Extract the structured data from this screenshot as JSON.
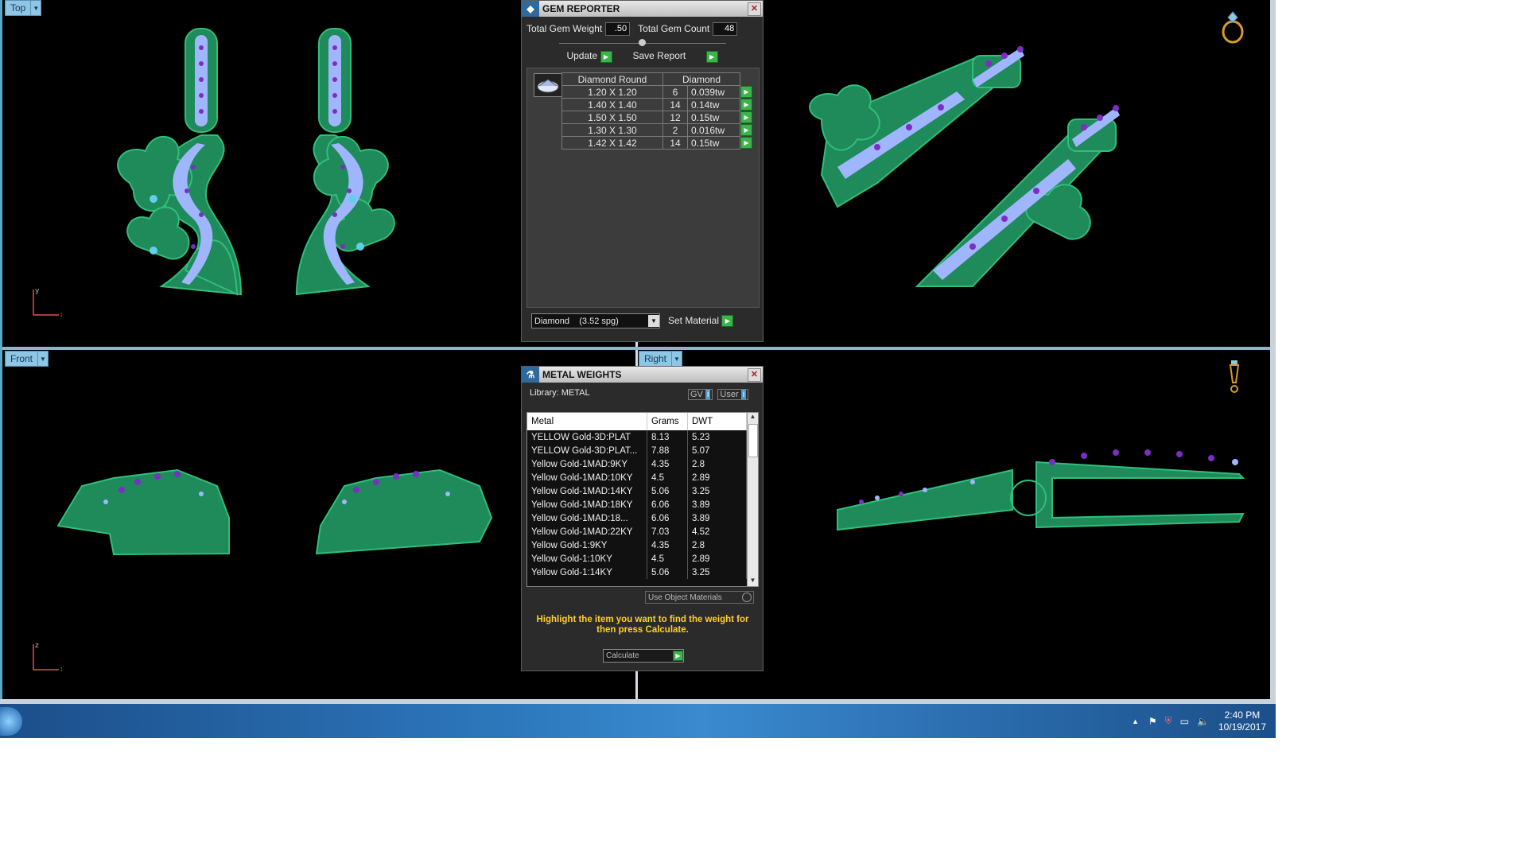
{
  "viewports": {
    "top": {
      "label": "Top"
    },
    "front": {
      "label": "Front"
    },
    "right": {
      "label": "Right"
    }
  },
  "gem_reporter": {
    "title": "GEM REPORTER",
    "total_weight_label": "Total Gem Weight",
    "total_weight_value": ".50",
    "total_count_label": "Total Gem Count",
    "total_count_value": "48",
    "update_label": "Update",
    "save_report_label": "Save Report",
    "columns": [
      "Diamond Round",
      "Diamond"
    ],
    "rows": [
      {
        "size": "1.20 X 1.20",
        "count": "6",
        "weight": "0.039tw"
      },
      {
        "size": "1.40 X 1.40",
        "count": "14",
        "weight": "0.14tw"
      },
      {
        "size": "1.50 X 1.50",
        "count": "12",
        "weight": "0.15tw"
      },
      {
        "size": "1.30 X 1.30",
        "count": "2",
        "weight": "0.016tw"
      },
      {
        "size": "1.42 X 1.42",
        "count": "14",
        "weight": "0.15tw"
      }
    ],
    "material_select": "Diamond    (3.52 spg)",
    "set_material_label": "Set Material"
  },
  "metal_weights": {
    "title": "METAL WEIGHTS",
    "library_label": "Library: METAL",
    "gv_label": "GV",
    "user_label": "User",
    "columns": [
      "Metal",
      "Grams",
      "DWT"
    ],
    "rows": [
      {
        "metal": "YELLOW Gold-3D:PLAT",
        "grams": "8.13",
        "dwt": "5.23"
      },
      {
        "metal": "YELLOW Gold-3D:PLAT...",
        "grams": "7.88",
        "dwt": "5.07"
      },
      {
        "metal": "Yellow Gold-1MAD:9KY",
        "grams": "4.35",
        "dwt": "2.8"
      },
      {
        "metal": "Yellow Gold-1MAD:10KY",
        "grams": "4.5",
        "dwt": "2.89"
      },
      {
        "metal": "Yellow Gold-1MAD:14KY",
        "grams": "5.06",
        "dwt": "3.25"
      },
      {
        "metal": "Yellow Gold-1MAD:18KY",
        "grams": "6.06",
        "dwt": "3.89"
      },
      {
        "metal": "Yellow Gold-1MAD:18...",
        "grams": "6.06",
        "dwt": "3.89"
      },
      {
        "metal": "Yellow Gold-1MAD:22KY",
        "grams": "7.03",
        "dwt": "4.52"
      },
      {
        "metal": "Yellow Gold-1:9KY",
        "grams": "4.35",
        "dwt": "2.8"
      },
      {
        "metal": "Yellow Gold-1:10KY",
        "grams": "4.5",
        "dwt": "2.89"
      },
      {
        "metal": "Yellow Gold-1:14KY",
        "grams": "5.06",
        "dwt": "3.25"
      }
    ],
    "use_object_materials_label": "Use Object Materials",
    "hint": "Highlight the item you want to find the weight for then press Calculate.",
    "calculate_label": "Calculate"
  },
  "taskbar": {
    "time": "2:40 PM",
    "date": "10/19/2017"
  },
  "colors": {
    "metal_green": "#1f8a5a",
    "gem_light": "#9fb6ff",
    "gem_purple": "#7a2fc2",
    "gem_cyan": "#5fd0e8",
    "hint_yellow": "#ffd21f"
  }
}
